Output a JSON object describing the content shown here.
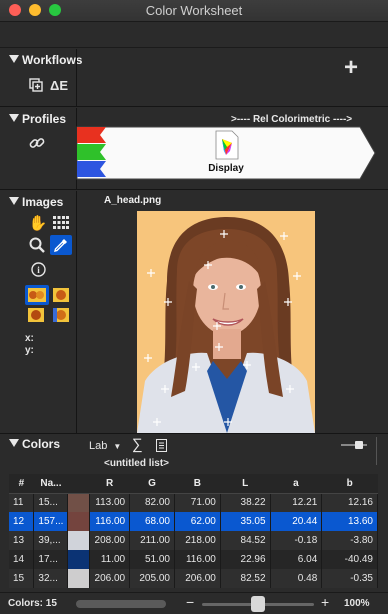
{
  "window": {
    "title": "Color Worksheet"
  },
  "workflows": {
    "title": "Workflows",
    "add_label": "+"
  },
  "profiles": {
    "title": "Profiles",
    "rendering_intent": ">---- Rel Colorimetric ---->",
    "profile_name": "Display"
  },
  "images": {
    "title": "Images",
    "filename": "A_head.png",
    "x_label": "x:",
    "y_label": "y:"
  },
  "colors": {
    "title": "Colors",
    "mode": "Lab",
    "sigma": "∑",
    "list_name": "<untitled list>",
    "columns": [
      "#",
      "Na...",
      "",
      "R",
      "G",
      "B",
      "L",
      "a",
      "b"
    ],
    "rows": [
      {
        "num": "11",
        "name": "15...",
        "swatch": "#715047",
        "r": "113.00",
        "g": "82.00",
        "b": "71.00",
        "L": "38.22",
        "a": "12.21",
        "bb": "12.16"
      },
      {
        "num": "12",
        "name": "157...",
        "swatch": "#74443e",
        "r": "116.00",
        "g": "68.00",
        "b": "62.00",
        "L": "35.05",
        "a": "20.44",
        "bb": "13.60"
      },
      {
        "num": "13",
        "name": "39,...",
        "swatch": "#d0d3da",
        "r": "208.00",
        "g": "211.00",
        "b": "218.00",
        "L": "84.52",
        "a": "-0.18",
        "bb": "-3.80"
      },
      {
        "num": "14",
        "name": "17...",
        "swatch": "#0b3374",
        "r": "11.00",
        "g": "51.00",
        "b": "116.00",
        "L": "22.96",
        "a": "6.04",
        "bb": "-40.49"
      },
      {
        "num": "15",
        "name": "32...",
        "swatch": "#cecdce",
        "r": "206.00",
        "g": "205.00",
        "b": "206.00",
        "L": "82.52",
        "a": "0.48",
        "bb": "-0.35"
      }
    ],
    "selected_row": 1
  },
  "status": {
    "count": "Colors: 15",
    "zoom": "100%",
    "minus": "−",
    "plus": "+",
    "zoom_slider_level": 0.5
  },
  "colors_accent": {
    "selection": "#0a58d0",
    "photo_bg": "#f7c57c"
  }
}
